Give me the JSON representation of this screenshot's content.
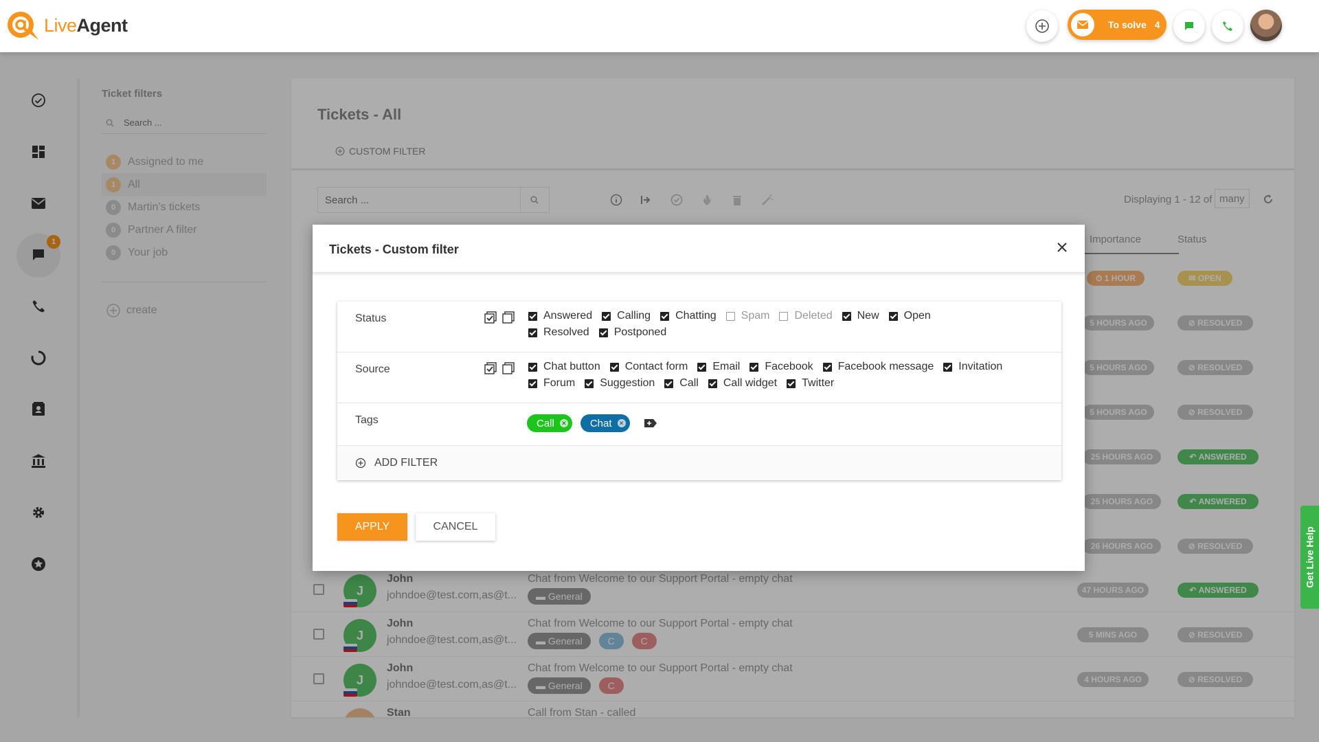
{
  "app": {
    "logo_main": "Live",
    "logo_bold": "Agent",
    "to_solve_label": "To solve",
    "to_solve_count": "4",
    "accent": "#f7941d"
  },
  "nav": {
    "badge": "1"
  },
  "filters": {
    "title": "Ticket filters",
    "search_placeholder": "Search ...",
    "items": [
      {
        "count": "1",
        "label": "Assigned to me"
      },
      {
        "count": "1",
        "label": "All"
      },
      {
        "count": "0",
        "label": "Martin's tickets"
      },
      {
        "count": "0",
        "label": "Partner A filter"
      },
      {
        "count": "0",
        "label": "Your job"
      }
    ],
    "create": "create"
  },
  "main": {
    "title": "Tickets - All",
    "custom_filter": "CUSTOM FILTER",
    "search_placeholder": "Search ...",
    "displaying": "Displaying 1 - 12 of",
    "many": "many",
    "col_importance": "Importance",
    "col_status": "Status",
    "rows": [
      {
        "avatar": "J",
        "name": "John",
        "email": "johndoe@test.com,as@t...",
        "subject": "Chat from Welcome to our Support Portal - empty chat",
        "tags": [
          "General"
        ],
        "time": "47 HOURS AGO",
        "status": "ANSWERED"
      },
      {
        "avatar": "J",
        "name": "John",
        "email": "johndoe@test.com,as@t...",
        "subject": "Chat from Welcome to our Support Portal - empty chat",
        "tags": [
          "General",
          "C",
          "C"
        ],
        "time": "5 MINS AGO",
        "status": "RESOLVED"
      },
      {
        "avatar": "J",
        "name": "John",
        "email": "johndoe@test.com,as@t...",
        "subject": "Chat from Welcome to our Support Portal - empty chat",
        "tags": [
          "General",
          "C"
        ],
        "time": "4 HOURS AGO",
        "status": "RESOLVED"
      },
      {
        "avatar": "",
        "name": "Stan",
        "email": "",
        "subject": "Call from Stan - called",
        "tags": [],
        "time": "",
        "status": ""
      }
    ],
    "status_column": [
      {
        "time": "1 HOUR",
        "status": "OPEN"
      },
      {
        "time": "5 HOURS AGO",
        "status": "RESOLVED"
      },
      {
        "time": "5 HOURS AGO",
        "status": "RESOLVED"
      },
      {
        "time": "5 HOURS AGO",
        "status": "RESOLVED"
      },
      {
        "time": "25 HOURS AGO",
        "status": "ANSWERED"
      },
      {
        "time": "25 HOURS AGO",
        "status": "ANSWERED"
      },
      {
        "time": "26 HOURS AGO",
        "status": "RESOLVED"
      }
    ]
  },
  "modal": {
    "title": "Tickets - Custom filter",
    "status_label": "Status",
    "status_options": [
      {
        "label": "Answered",
        "checked": true
      },
      {
        "label": "Calling",
        "checked": true
      },
      {
        "label": "Chatting",
        "checked": true
      },
      {
        "label": "Spam",
        "checked": false
      },
      {
        "label": "Deleted",
        "checked": false
      },
      {
        "label": "New",
        "checked": true
      },
      {
        "label": "Open",
        "checked": true
      },
      {
        "label": "Resolved",
        "checked": true
      },
      {
        "label": "Postponed",
        "checked": true
      }
    ],
    "source_label": "Source",
    "source_options": [
      {
        "label": "Chat button",
        "checked": true
      },
      {
        "label": "Contact form",
        "checked": true
      },
      {
        "label": "Email",
        "checked": true
      },
      {
        "label": "Facebook",
        "checked": true
      },
      {
        "label": "Facebook message",
        "checked": true
      },
      {
        "label": "Invitation",
        "checked": true
      },
      {
        "label": "Forum",
        "checked": true
      },
      {
        "label": "Suggestion",
        "checked": true
      },
      {
        "label": "Call",
        "checked": true
      },
      {
        "label": "Call widget",
        "checked": true
      },
      {
        "label": "Twitter",
        "checked": true
      }
    ],
    "tags_label": "Tags",
    "tags": [
      {
        "label": "Call",
        "color": "#1cc41c"
      },
      {
        "label": "Chat",
        "color": "#0f6ea3"
      }
    ],
    "add_filter": "ADD FILTER",
    "apply": "APPLY",
    "cancel": "CANCEL"
  },
  "live_help": "Get Live Help"
}
